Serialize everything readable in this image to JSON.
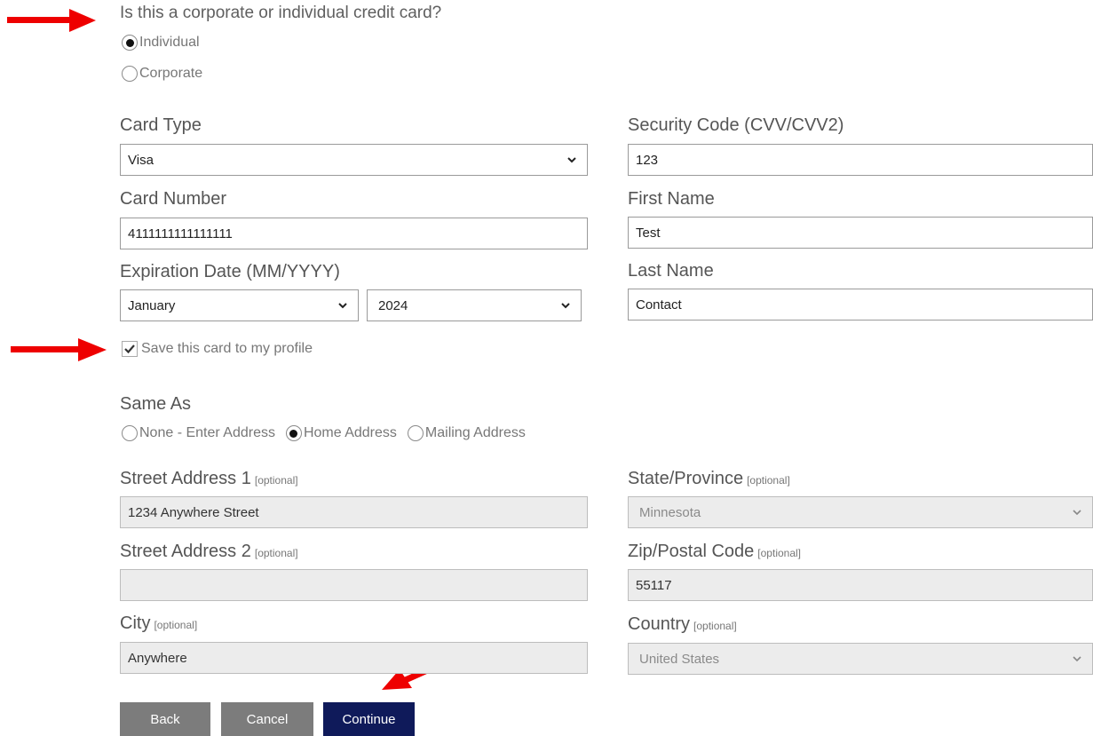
{
  "card_kind": {
    "question": "Is this a corporate or individual credit card?",
    "options": [
      {
        "label": "Individual",
        "selected": true
      },
      {
        "label": "Corporate",
        "selected": false
      }
    ]
  },
  "card": {
    "type_label": "Card Type",
    "type_value": "Visa",
    "number_label": "Card Number",
    "number_value": "4111111111111111",
    "expiration_label": "Expiration Date (MM/YYYY)",
    "exp_month": "January",
    "exp_year": "2024",
    "cvv_label": "Security Code (CVV/CVV2)",
    "cvv_value": "123",
    "first_name_label": "First Name",
    "first_name_value": "Test",
    "last_name_label": "Last Name",
    "last_name_value": "Contact",
    "save_label": "Save this card to my profile",
    "save_checked": true
  },
  "same_as": {
    "label": "Same As",
    "options": [
      {
        "label": "None - Enter Address",
        "selected": false
      },
      {
        "label": "Home Address",
        "selected": true
      },
      {
        "label": "Mailing Address",
        "selected": false
      }
    ]
  },
  "address": {
    "optional_tag": "[optional]",
    "street1_label": "Street Address 1",
    "street1_value": "1234 Anywhere Street",
    "street2_label": "Street Address 2",
    "street2_value": "",
    "city_label": "City",
    "city_value": "Anywhere",
    "state_label": "State/Province",
    "state_value": "Minnesota",
    "zip_label": "Zip/Postal Code",
    "zip_value": "55117",
    "country_label": "Country",
    "country_value": "United States"
  },
  "buttons": {
    "back": "Back",
    "cancel": "Cancel",
    "continue": "Continue"
  },
  "colors": {
    "annotation_arrow": "#ee0000",
    "primary_button": "#0f1a5a",
    "secondary_button": "#7c7c7c"
  }
}
